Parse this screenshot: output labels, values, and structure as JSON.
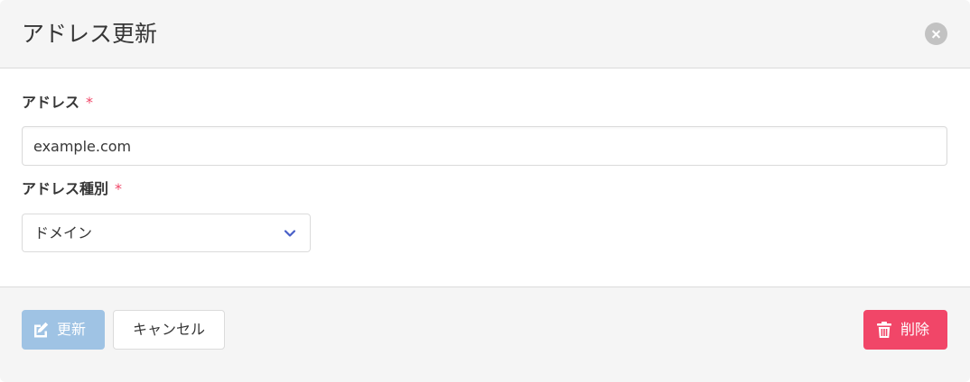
{
  "modal": {
    "title": "アドレス更新"
  },
  "form": {
    "address": {
      "label": "アドレス",
      "required_mark": "*",
      "value": "example.com"
    },
    "address_type": {
      "label": "アドレス種別",
      "required_mark": "*",
      "selected": "ドメイン"
    }
  },
  "footer": {
    "update_label": "更新",
    "cancel_label": "キャンセル",
    "delete_label": "削除"
  },
  "icons": {
    "close": "close-icon",
    "chevron": "chevron-down-icon",
    "edit": "edit-icon",
    "trash": "trash-icon"
  },
  "colors": {
    "primary_disabled": "#9fc3e4",
    "danger": "#f14668",
    "required": "#f14668",
    "select_arrow": "#485fc7"
  }
}
